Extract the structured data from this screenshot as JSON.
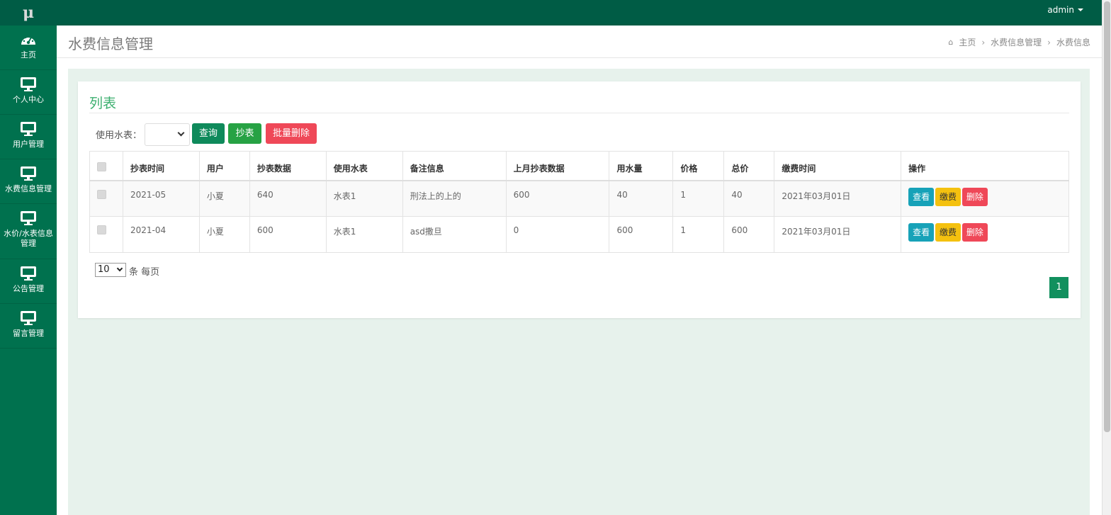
{
  "app": {
    "logo": "μ",
    "user": "admin"
  },
  "sidebar": {
    "items": [
      {
        "label": "主页",
        "icon": "dashboard-icon"
      },
      {
        "label": "个人中心",
        "icon": "monitor-icon"
      },
      {
        "label": "用户管理",
        "icon": "monitor-icon"
      },
      {
        "label": "水费信息管理",
        "icon": "monitor-icon"
      },
      {
        "label": "水价/水表信息管理",
        "icon": "monitor-icon"
      },
      {
        "label": "公告管理",
        "icon": "monitor-icon"
      },
      {
        "label": "留言管理",
        "icon": "monitor-icon"
      }
    ]
  },
  "header": {
    "title": "水费信息管理",
    "breadcrumb": [
      "主页",
      "水费信息管理",
      "水费信息"
    ]
  },
  "panel": {
    "title": "列表",
    "filter_label": "使用水表：",
    "filter_value": "",
    "buttons": {
      "query": "查询",
      "read": "抄表",
      "batch_delete": "批量删除"
    }
  },
  "table": {
    "columns": [
      "抄表时间",
      "用户",
      "抄表数据",
      "使用水表",
      "备注信息",
      "上月抄表数据",
      "用水量",
      "价格",
      "总价",
      "缴费时间",
      "操作"
    ],
    "rows": [
      [
        "2021-05",
        "小夏",
        "640",
        "水表1",
        "刑法上的上的",
        "600",
        "40",
        "1",
        "40",
        "2021年03月01日"
      ],
      [
        "2021-04",
        "小夏",
        "600",
        "水表1",
        "asd撒旦",
        "0",
        "600",
        "1",
        "600",
        "2021年03月01日"
      ]
    ],
    "actions": {
      "view": "查看",
      "pay": "缴费",
      "delete": "删除"
    }
  },
  "pagination": {
    "page_size": "10",
    "per_page_label": "条 每页",
    "current_page": "1"
  },
  "colors": {
    "topbar": "#005c45",
    "sidebar": "#00714e",
    "accent": "#3caf6f",
    "danger": "#ef4858",
    "info": "#17a2b8",
    "warning": "#f4c10f"
  }
}
